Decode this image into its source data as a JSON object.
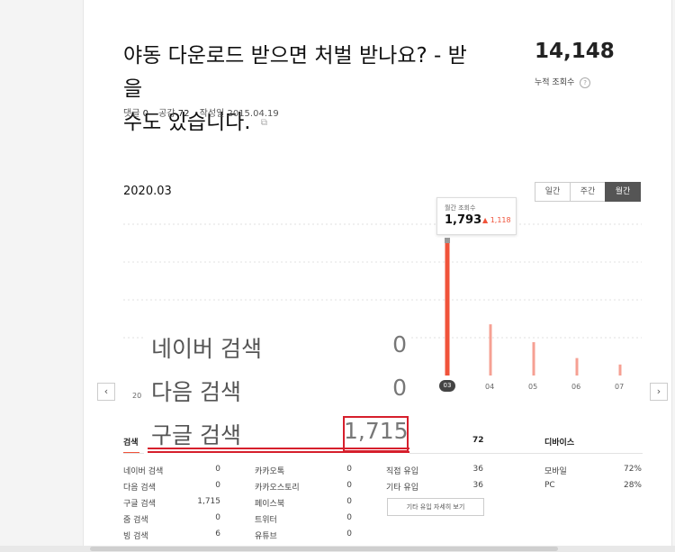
{
  "post": {
    "title_line1": "야동 다운로드 받으면 처벌 받나요? - 받을",
    "title_line2": "수도 있습니다.",
    "comments_label": "댓글",
    "comments": "0",
    "likes_label": "공감",
    "likes": "72",
    "date_label": "작성일",
    "date": "2015.04.19"
  },
  "views": {
    "total": "14,148",
    "label": "누적 조회수",
    "help": "?"
  },
  "period": "2020.03",
  "toggle": [
    "일간",
    "주간",
    "월간"
  ],
  "toggle_active": 2,
  "tooltip": {
    "label": "월간 조회수",
    "value": "1,793",
    "delta": "▲ 1,118"
  },
  "chart_data": {
    "type": "bar",
    "categories": [
      "03",
      "04",
      "05",
      "06",
      "07"
    ],
    "values": [
      1793,
      675,
      440,
      230,
      145
    ],
    "highlight_index": 0,
    "colors": {
      "highlight": "#f0533a",
      "normal": "#f6a093"
    },
    "grid": true
  },
  "nav": {
    "prev": "‹",
    "next": "›"
  },
  "partial_axis_label": "20",
  "overlay": {
    "rows": [
      {
        "label": "네이버 검색",
        "value": "0"
      },
      {
        "label": "다음 검색",
        "value": "0"
      },
      {
        "label": "구글 검색",
        "value": "1,715"
      }
    ]
  },
  "tabs": {
    "search": "검색",
    "count": "72",
    "device": "디바이스"
  },
  "table_col1": [
    {
      "label": "네이버 검색",
      "value": "0"
    },
    {
      "label": "다음 검색",
      "value": "0"
    },
    {
      "label": "구글 검색",
      "value": "1,715"
    },
    {
      "label": "줌 검색",
      "value": "0"
    },
    {
      "label": "빙 검색",
      "value": "6"
    }
  ],
  "table_col2": [
    {
      "label": "카카오톡",
      "value": "0"
    },
    {
      "label": "카카오스토리",
      "value": "0"
    },
    {
      "label": "페이스북",
      "value": "0"
    },
    {
      "label": "트위터",
      "value": "0"
    },
    {
      "label": "유튜브",
      "value": "0"
    }
  ],
  "table_col3": [
    {
      "label": "직접 유입",
      "value": "36"
    },
    {
      "label": "기타 유입",
      "value": "36"
    }
  ],
  "detail_button": "기타 유입 자세히 보기",
  "table_col4": [
    {
      "label": "모바일",
      "value": "72%"
    },
    {
      "label": "PC",
      "value": "28%"
    }
  ]
}
